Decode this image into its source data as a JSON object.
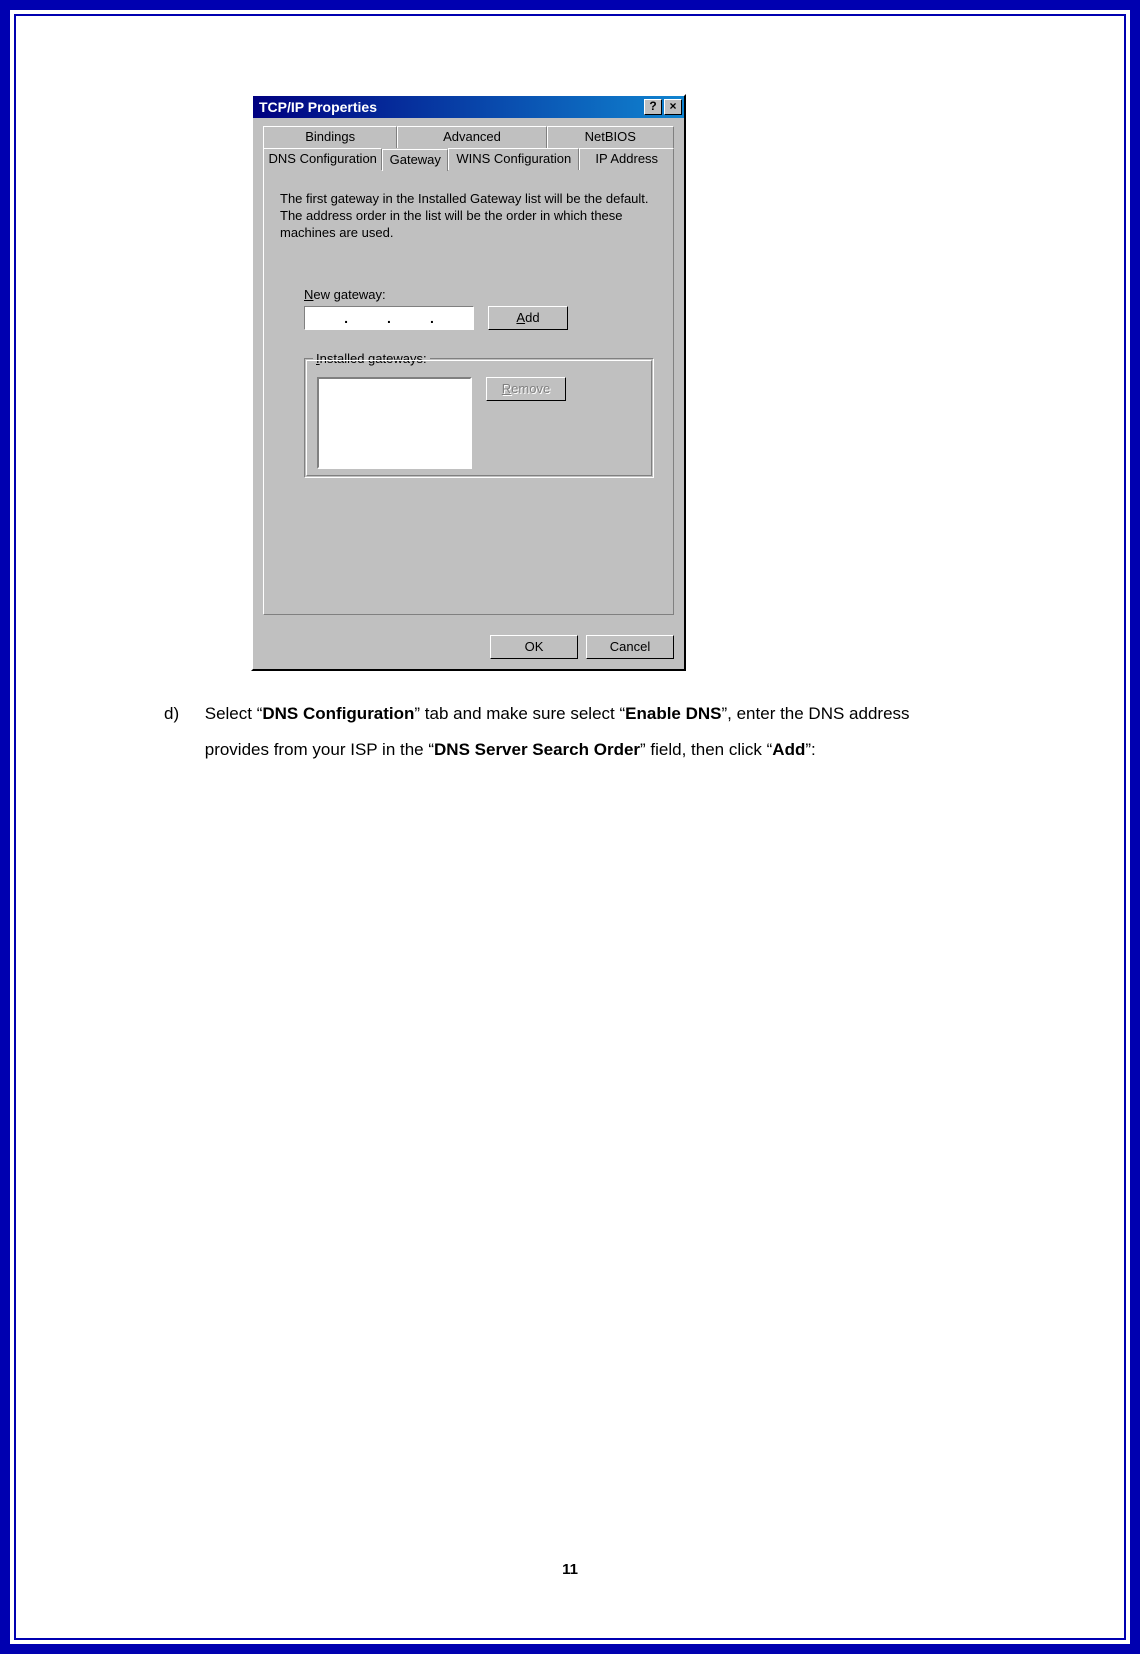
{
  "dialog": {
    "title": "TCP/IP Properties",
    "help_icon": "?",
    "close_icon": "×",
    "tabs_row1": [
      "Bindings",
      "Advanced",
      "NetBIOS"
    ],
    "tabs_row2": [
      "DNS Configuration",
      "Gateway",
      "WINS Configuration",
      "IP Address"
    ],
    "active_tab_index": 1,
    "info": "The first gateway in the Installed Gateway list will be the default. The address order in the list will be the order in which these machines are used.",
    "new_gateway_label": "New gateway:",
    "ip_dots": ".",
    "add_btn": "Add",
    "installed_label": "Installed gateways:",
    "remove_btn": "Remove",
    "ok_btn": "OK",
    "cancel_btn": "Cancel"
  },
  "instruction": {
    "marker": "d)",
    "parts": [
      {
        "t": "Select “",
        "b": false
      },
      {
        "t": "DNS Configuration",
        "b": true
      },
      {
        "t": "” tab and make sure select “",
        "b": false
      },
      {
        "t": "Enable DNS",
        "b": true
      },
      {
        "t": "”, enter the DNS address provides from your ISP in the “",
        "b": false
      },
      {
        "t": "DNS Server Search Order",
        "b": true
      },
      {
        "t": "” field, then click “",
        "b": false
      },
      {
        "t": "Add",
        "b": true
      },
      {
        "t": "”:",
        "b": false
      }
    ]
  },
  "page_number": "11"
}
